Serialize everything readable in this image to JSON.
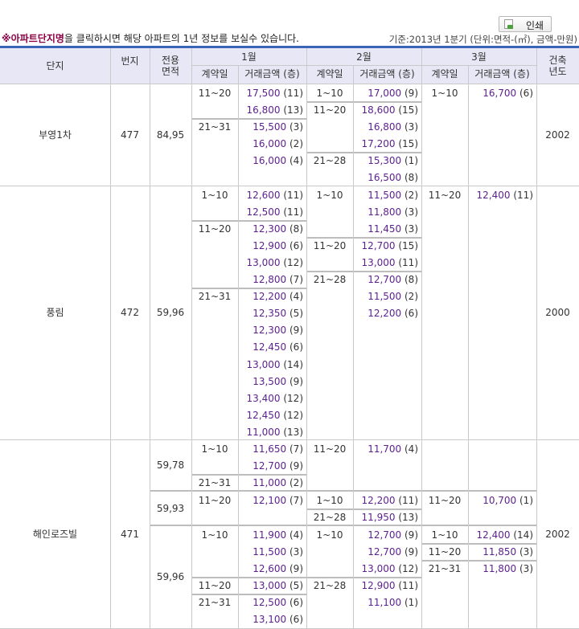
{
  "print_button": {
    "label": "인쇄"
  },
  "notice": {
    "highlight": "※아파트단지명",
    "text": "을 클릭하시면 해당 아파트의 1년 정보를 보실수 있습니다."
  },
  "basis": "기준:2013년 1분기   (단위:면적-(㎡), 금액-만원)",
  "header": {
    "danji": "단지",
    "beonji": "번지",
    "area": "전용\n면적",
    "months": [
      "1월",
      "2월",
      "3월"
    ],
    "built": "건축\n년도",
    "contract_day": "계약일",
    "price": "거래금액 (층)"
  },
  "complexes": [
    {
      "name": "부영1차",
      "beonji": "477",
      "built": "2002",
      "areas": [
        {
          "area": "84,95",
          "months": [
            {
              "groups": [
                {
                  "day": "11~20",
                  "rows": [
                    [
                      "17,500",
                      "(11)"
                    ],
                    [
                      "16,800",
                      "(13)"
                    ]
                  ]
                },
                {
                  "day": "21~31",
                  "rows": [
                    [
                      "15,500",
                      "(3)"
                    ],
                    [
                      "16,000",
                      "(2)"
                    ],
                    [
                      "16,000",
                      "(4)"
                    ]
                  ]
                }
              ]
            },
            {
              "groups": [
                {
                  "day": "1~10",
                  "rows": [
                    [
                      "17,000",
                      "(9)"
                    ]
                  ]
                },
                {
                  "day": "11~20",
                  "rows": [
                    [
                      "18,600",
                      "(15)"
                    ],
                    [
                      "16,800",
                      "(3)"
                    ],
                    [
                      "17,200",
                      "(15)"
                    ]
                  ]
                },
                {
                  "day": "21~28",
                  "rows": [
                    [
                      "15,300",
                      "(1)"
                    ],
                    [
                      "16,500",
                      "(8)"
                    ]
                  ]
                }
              ]
            },
            {
              "groups": [
                {
                  "day": "1~10",
                  "rows": [
                    [
                      "16,700",
                      "(6)"
                    ]
                  ]
                }
              ]
            }
          ]
        }
      ]
    },
    {
      "name": "풍림",
      "beonji": "472",
      "built": "2000",
      "areas": [
        {
          "area": "59,96",
          "months": [
            {
              "groups": [
                {
                  "day": "1~10",
                  "rows": [
                    [
                      "12,600",
                      "(11)"
                    ],
                    [
                      "12,500",
                      "(11)"
                    ]
                  ]
                },
                {
                  "day": "11~20",
                  "rows": [
                    [
                      "12,300",
                      "(8)"
                    ],
                    [
                      "12,900",
                      "(6)"
                    ],
                    [
                      "13,000",
                      "(12)"
                    ],
                    [
                      "12,800",
                      "(7)"
                    ]
                  ]
                },
                {
                  "day": "21~31",
                  "rows": [
                    [
                      "12,200",
                      "(4)"
                    ],
                    [
                      "12,350",
                      "(5)"
                    ],
                    [
                      "12,300",
                      "(9)"
                    ],
                    [
                      "12,450",
                      "(6)"
                    ],
                    [
                      "13,000",
                      "(14)"
                    ],
                    [
                      "13,500",
                      "(9)"
                    ],
                    [
                      "13,400",
                      "(12)"
                    ],
                    [
                      "12,450",
                      "(12)"
                    ],
                    [
                      "11,000",
                      "(13)"
                    ]
                  ]
                }
              ]
            },
            {
              "groups": [
                {
                  "day": "1~10",
                  "rows": [
                    [
                      "11,500",
                      "(2)"
                    ],
                    [
                      "11,800",
                      "(3)"
                    ],
                    [
                      "11,450",
                      "(3)"
                    ]
                  ]
                },
                {
                  "day": "11~20",
                  "rows": [
                    [
                      "12,700",
                      "(15)"
                    ],
                    [
                      "13,000",
                      "(11)"
                    ]
                  ]
                },
                {
                  "day": "21~28",
                  "rows": [
                    [
                      "12,700",
                      "(8)"
                    ],
                    [
                      "11,500",
                      "(2)"
                    ],
                    [
                      "12,200",
                      "(6)"
                    ]
                  ]
                }
              ]
            },
            {
              "groups": [
                {
                  "day": "11~20",
                  "rows": [
                    [
                      "12,400",
                      "(11)"
                    ]
                  ]
                }
              ]
            }
          ]
        }
      ]
    },
    {
      "name": "해인로즈빌",
      "beonji": "471",
      "built": "2002",
      "areas": [
        {
          "area": "59,78",
          "months": [
            {
              "groups": [
                {
                  "day": "1~10",
                  "rows": [
                    [
                      "11,650",
                      "(7)"
                    ],
                    [
                      "12,700",
                      "(9)"
                    ]
                  ]
                },
                {
                  "day": "21~31",
                  "rows": [
                    [
                      "11,000",
                      "(2)"
                    ]
                  ]
                }
              ]
            },
            {
              "groups": [
                {
                  "day": "11~20",
                  "rows": [
                    [
                      "11,700",
                      "(4)"
                    ]
                  ]
                }
              ]
            },
            {
              "groups": []
            }
          ]
        },
        {
          "area": "59,93",
          "months": [
            {
              "groups": [
                {
                  "day": "11~20",
                  "rows": [
                    [
                      "12,100",
                      "(7)"
                    ]
                  ]
                }
              ]
            },
            {
              "groups": [
                {
                  "day": "1~10",
                  "rows": [
                    [
                      "12,200",
                      "(11)"
                    ]
                  ]
                },
                {
                  "day": "21~28",
                  "rows": [
                    [
                      "11,950",
                      "(13)"
                    ]
                  ]
                }
              ]
            },
            {
              "groups": [
                {
                  "day": "11~20",
                  "rows": [
                    [
                      "10,700",
                      "(1)"
                    ]
                  ]
                }
              ]
            }
          ]
        },
        {
          "area": "59,96",
          "months": [
            {
              "groups": [
                {
                  "day": "1~10",
                  "rows": [
                    [
                      "11,900",
                      "(4)"
                    ],
                    [
                      "11,500",
                      "(3)"
                    ],
                    [
                      "12,600",
                      "(9)"
                    ]
                  ]
                },
                {
                  "day": "11~20",
                  "rows": [
                    [
                      "13,000",
                      "(5)"
                    ]
                  ]
                },
                {
                  "day": "21~31",
                  "rows": [
                    [
                      "12,500",
                      "(6)"
                    ],
                    [
                      "13,100",
                      "(6)"
                    ]
                  ]
                }
              ]
            },
            {
              "groups": [
                {
                  "day": "1~10",
                  "rows": [
                    [
                      "12,700",
                      "(9)"
                    ],
                    [
                      "12,700",
                      "(9)"
                    ],
                    [
                      "13,000",
                      "(12)"
                    ]
                  ]
                },
                {
                  "day": "21~28",
                  "rows": [
                    [
                      "12,900",
                      "(11)"
                    ],
                    [
                      "11,100",
                      "(1)"
                    ]
                  ]
                }
              ]
            },
            {
              "groups": [
                {
                  "day": "1~10",
                  "rows": [
                    [
                      "12,400",
                      "(14)"
                    ]
                  ]
                },
                {
                  "day": "11~20",
                  "rows": [
                    [
                      "11,850",
                      "(3)"
                    ]
                  ]
                },
                {
                  "day": "21~31",
                  "rows": [
                    [
                      "11,800",
                      "(3)"
                    ]
                  ]
                }
              ]
            }
          ]
        }
      ]
    }
  ]
}
